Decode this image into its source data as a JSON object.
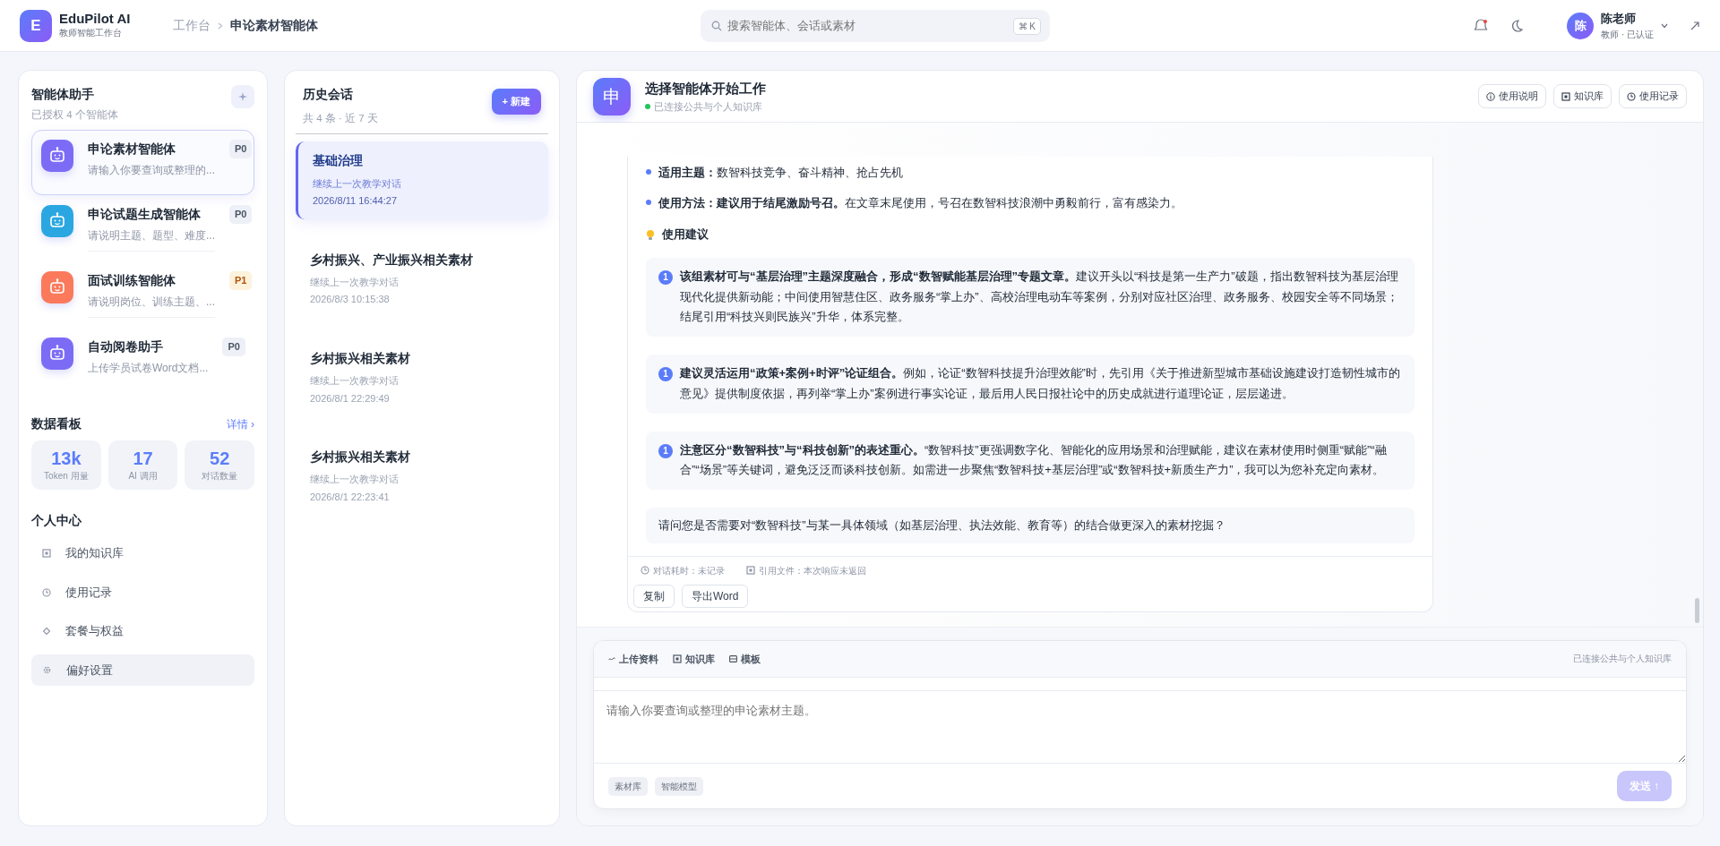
{
  "header": {
    "logo_letter": "E",
    "app_name": "EduPilot AI",
    "app_subtitle": "教师智能工作台",
    "breadcrumb": [
      "工作台",
      "申论素材智能体"
    ],
    "search": {
      "placeholder": "搜索智能体、会话或素材",
      "shortcut": "⌘ K"
    },
    "user": {
      "avatar": "陈",
      "name": "陈老师",
      "role": "教师 · 已认证"
    }
  },
  "agents_panel": {
    "title": "智能体助手",
    "subtitle": "已授权 4 个智能体",
    "agents": [
      {
        "name": "申论素材智能体",
        "desc": "请输入你要查询或整理的...",
        "priority": "P0",
        "selected": true,
        "color": "#7c6cf5"
      },
      {
        "name": "申论试题生成智能体",
        "desc": "请说明主题、题型、难度...",
        "priority": "P0",
        "selected": false,
        "color": "#2aa7e0"
      },
      {
        "name": "面试训练智能体",
        "desc": "请说明岗位、训练主题、...",
        "priority": "P1",
        "selected": false,
        "color": "#fb7a5c"
      },
      {
        "name": "自动阅卷助手",
        "desc": "上传学员试卷Word文档...",
        "priority": "P0",
        "selected": false,
        "color": "#7c6cf5"
      }
    ]
  },
  "dashboard": {
    "title": "数据看板",
    "link": "详情 ›",
    "stats": [
      {
        "value": "13k",
        "label": "Token 用量"
      },
      {
        "value": "17",
        "label": "AI 调用"
      },
      {
        "value": "52",
        "label": "对话数量"
      }
    ]
  },
  "personal": {
    "title": "个人中心",
    "items": [
      {
        "label": "我的知识库",
        "kind": "square",
        "selected": false
      },
      {
        "label": "使用记录",
        "kind": "clock",
        "selected": false
      },
      {
        "label": "套餐与权益",
        "kind": "diamond",
        "selected": false
      },
      {
        "label": "偏好设置",
        "kind": "gear",
        "selected": true
      }
    ]
  },
  "history": {
    "title": "历史会话",
    "new_button": "+ 新建",
    "meta": "共 4 条 · 近 7 天",
    "sessions": [
      {
        "title": "基础治理",
        "subtitle": "继续上一次教学对话",
        "time": "2026/8/11 16:44:27",
        "selected": true
      },
      {
        "title": "乡村振兴、产业振兴相关素材",
        "subtitle": "继续上一次教学对话",
        "time": "2026/8/3 10:15:38",
        "selected": false
      },
      {
        "title": "乡村振兴相关素材",
        "subtitle": "继续上一次教学对话",
        "time": "2026/8/1 22:29:49",
        "selected": false
      },
      {
        "title": "乡村振兴相关素材",
        "subtitle": "继续上一次教学对话",
        "time": "2026/8/1 22:23:41",
        "selected": false
      }
    ]
  },
  "chat": {
    "avatar": "申",
    "title": "选择智能体开始工作",
    "status": "已连接公共与个人知识库",
    "buttons": [
      {
        "label": "使用说明",
        "kind": "info"
      },
      {
        "label": "知识库",
        "kind": "square"
      },
      {
        "label": "使用记录",
        "kind": "clock"
      }
    ],
    "message": {
      "bullets": [
        "**适用主题：**数智科技竞争、奋斗精神、抢占先机",
        "**使用方法：建议用于结尾激励号召。**在文章末尾使用，号召在数智科技浪潮中勇毅前行，富有感染力。"
      ],
      "section_title": "使用建议",
      "suggestions": [
        {
          "number": "1",
          "text": "**该组素材可与“基层治理”主题深度融合，形成“数智赋能基层治理”专题文章。**建议开头以“科技是第一生产力”破题，指出数智科技为基层治理现代化提供新动能；中间使用智慧住区、政务服务“掌上办”、高校治理电动车等案例，分别对应社区治理、政务服务、校园安全等不同场景；结尾引用“科技兴则民族兴”升华，体系完整。"
        },
        {
          "number": "1",
          "text": "**建议灵活运用“政策+案例+时评”论证组合。**例如，论证“数智科技提升治理效能”时，先引用《关于推进新型城市基础设施建设打造韧性城市的意见》提供制度依据，再列举“掌上办”案例进行事实论证，最后用人民日报社论中的历史成就进行道理论证，层层递进。"
        },
        {
          "number": "1",
          "text": "**注意区分“数智科技”与“科技创新”的表述重心。**“数智科技”更强调数字化、智能化的应用场景和治理赋能，建议在素材使用时侧重“赋能”“融合”“场景”等关键词，避免泛泛而谈科技创新。如需进一步聚焦“数智科技+基层治理”或“数智科技+新质生产力”，我可以为您补充定向素材。"
        }
      ],
      "question": "请问您是否需要对“数智科技”与某一具体领域（如基层治理、执法效能、教育等）的结合做更深入的素材挖掘？",
      "meta": [
        {
          "text": "对话耗时：未记录",
          "kind": "clock"
        },
        {
          "text": "引用文件：本次响应未返回",
          "kind": "square"
        }
      ],
      "actions": [
        "复制",
        "导出Word"
      ]
    },
    "composer": {
      "tools": [
        {
          "label": "上传资料",
          "kind": "tilde"
        },
        {
          "label": "知识库",
          "kind": "square"
        },
        {
          "label": "模板",
          "kind": "template"
        }
      ],
      "status": "已连接公共与个人知识库",
      "placeholder": "请输入你要查询或整理的申论素材主题。",
      "tags": [
        "素材库",
        "智能模型"
      ],
      "send": {
        "label": "发送 ↑",
        "disabled": true
      }
    }
  }
}
